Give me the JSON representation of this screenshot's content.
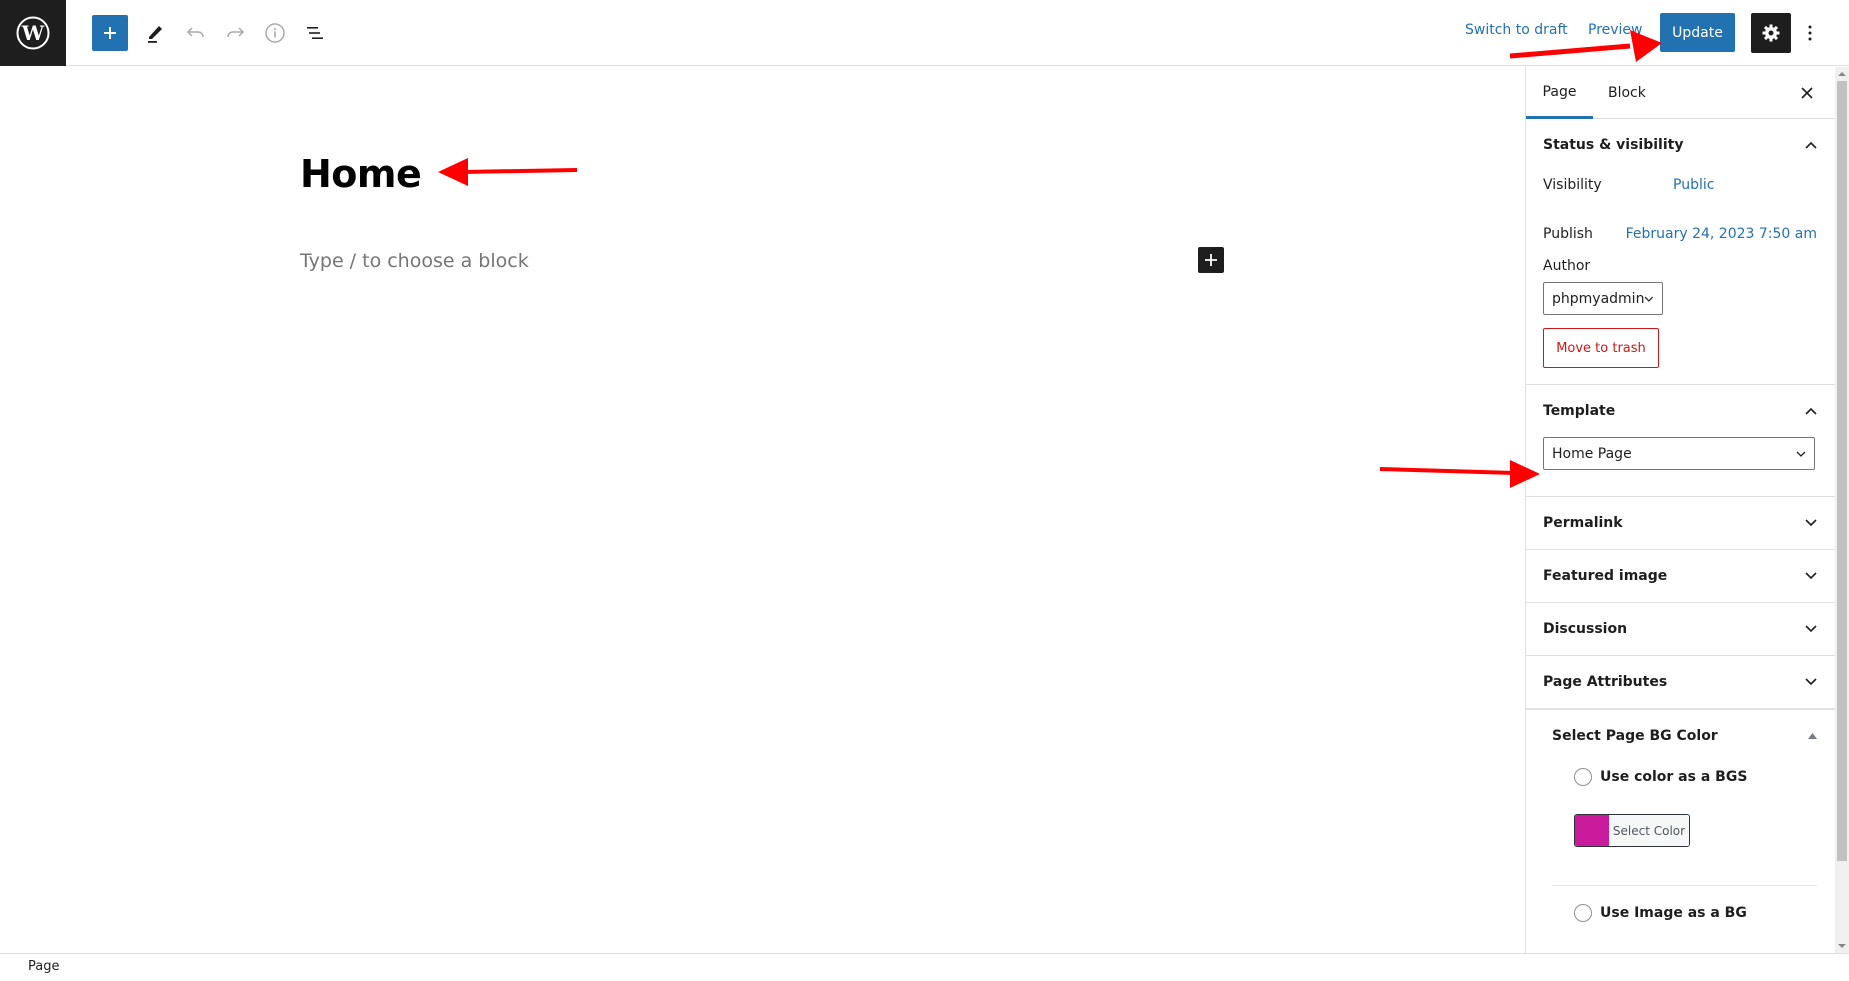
{
  "header": {
    "logo": "wordpress-logo",
    "toolbar": {
      "inserter_icon": "plus-icon",
      "tools_icon": "pencil-icon",
      "undo_icon": "undo-icon",
      "redo_icon": "redo-icon",
      "details_icon": "info-icon",
      "list_view_icon": "list-view-icon"
    },
    "switch_to_draft": "Switch to draft",
    "preview": "Preview",
    "update": "Update",
    "settings_icon": "gear-icon",
    "more_icon": "more-vertical-icon",
    "accent_color": "#2271b1"
  },
  "editor": {
    "title": "Home",
    "block_placeholder": "Type / to choose a block"
  },
  "sidebar": {
    "tabs": [
      {
        "label": "Page",
        "active": true
      },
      {
        "label": "Block",
        "active": false
      }
    ],
    "status_visibility": {
      "title": "Status & visibility",
      "visibility_label": "Visibility",
      "visibility_value": "Public",
      "publish_label": "Publish",
      "publish_value": "February 24, 2023 7:50 am",
      "author_label": "Author",
      "author_value": "phpmyadmin",
      "trash_label": "Move to trash"
    },
    "template": {
      "title": "Template",
      "value": "Home Page"
    },
    "collapsed_panels": [
      {
        "title": "Permalink"
      },
      {
        "title": "Featured image"
      },
      {
        "title": "Discussion"
      },
      {
        "title": "Page Attributes"
      }
    ],
    "bg_color_panel": {
      "title": "Select Page BG Color",
      "option_color": "Use color as a BGS",
      "select_color_label": "Select Color",
      "swatch_color": "#c91b9b",
      "option_image": "Use Image as a BG"
    }
  },
  "footer": {
    "breadcrumb": "Page"
  }
}
